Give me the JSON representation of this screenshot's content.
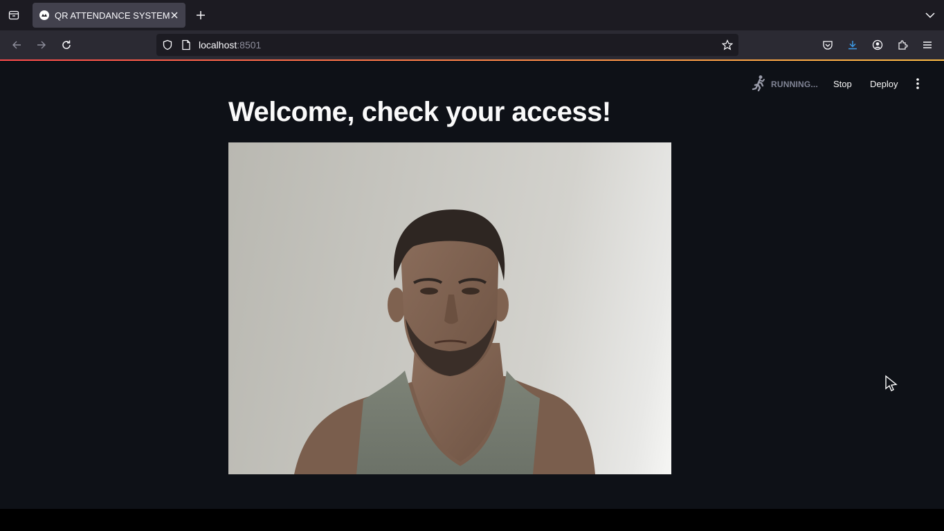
{
  "browser": {
    "tab": {
      "title": "QR ATTENDANCE SYSTEM"
    },
    "url": {
      "host": "localhost",
      "port": ":8501"
    }
  },
  "app": {
    "status": {
      "running_label": "RUNNING..."
    },
    "header": {
      "stop_label": "Stop",
      "deploy_label": "Deploy"
    },
    "title": "Welcome, check your access!",
    "camera": {
      "icon": "webcam-video-frame"
    }
  },
  "colors": {
    "app_background": "#0e1117",
    "accent_gradient_start": "#ff4b4b",
    "accent_gradient_end": "#ffbd45",
    "browser_chrome": "#2b2a33"
  }
}
